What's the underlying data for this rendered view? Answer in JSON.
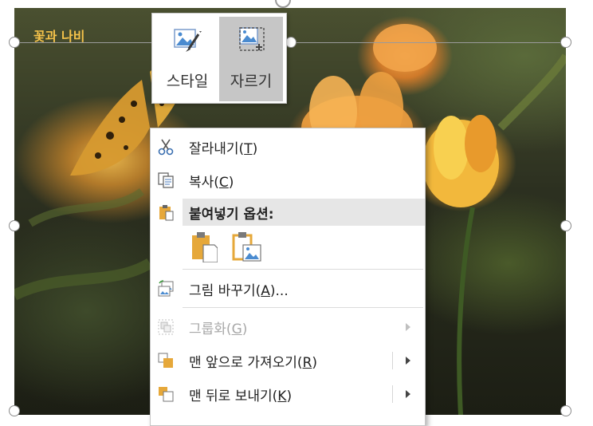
{
  "picture": {
    "title": "꽃과 나비"
  },
  "mini_toolbar": {
    "style_label": "스타일",
    "crop_label": "자르기"
  },
  "context_menu": {
    "cut": {
      "text": "잘라내기(",
      "key": "T",
      "close": ")"
    },
    "copy": {
      "text": "복사(",
      "key": "C",
      "close": ")"
    },
    "paste_options": {
      "text": "붙여넣기 옵션:"
    },
    "change_picture": {
      "text": "그림 바꾸기(",
      "key": "A",
      "close": ")..."
    },
    "group": {
      "text": "그룹화(",
      "key": "G",
      "close": ")"
    },
    "bring_front": {
      "text": "맨 앞으로 가져오기(",
      "key": "R",
      "close": ")"
    },
    "send_back": {
      "text": "맨 뒤로 보내기(",
      "key": "K",
      "close": ")"
    }
  },
  "colors": {
    "title": "#f4c24a",
    "active_button": "#c6c6c6",
    "paste_header": "#e6e6e6",
    "clipboard_gold": "#e6a83a"
  }
}
